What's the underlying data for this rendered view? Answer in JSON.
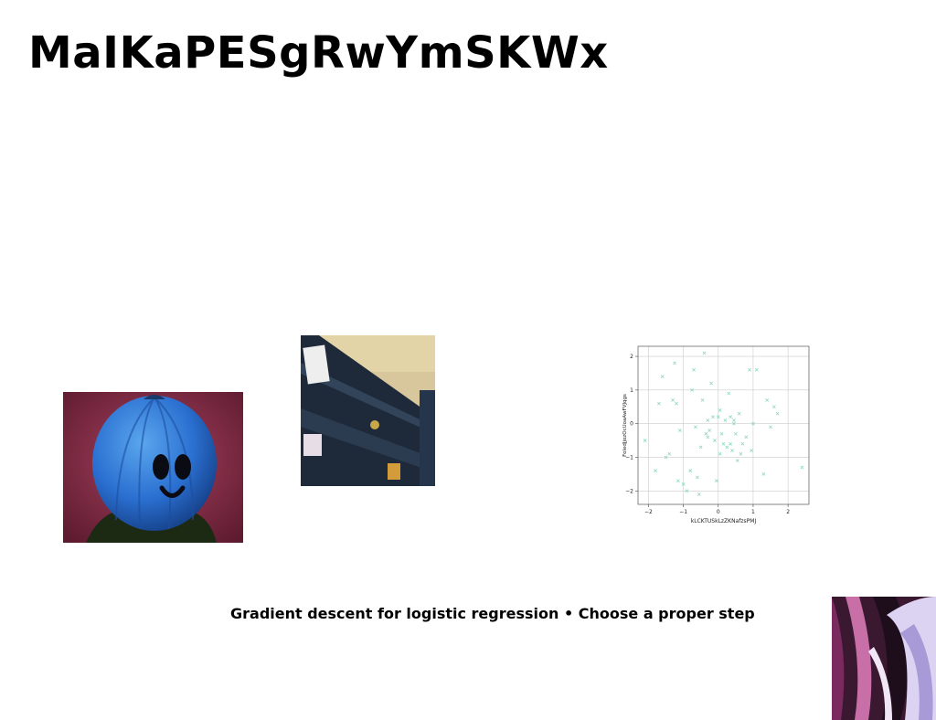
{
  "slide": {
    "title": "MaIKaPESgRwYmSKWx",
    "caption": "Gradient descent for logistic regression • Choose a proper step"
  },
  "colors": {
    "background": "#ffffff",
    "text": "#000000",
    "marker": "#8fd8c0"
  },
  "chart_data": {
    "type": "scatter",
    "title": "",
    "xlabel": "kLCKTUSkLzZKNafzsPMJ",
    "ylabel": "FoledJjozOcUoaAwFVJqgs",
    "xlim": [
      -2.3,
      2.6
    ],
    "ylim": [
      -2.4,
      2.3
    ],
    "xticks": [
      "-2",
      "-1",
      "0",
      "1",
      "2"
    ],
    "yticks": [
      "-2",
      "-1",
      "0",
      "1",
      "2"
    ],
    "grid": true,
    "marker": "x",
    "x": [
      -2.1,
      -1.8,
      -1.7,
      -1.6,
      -1.5,
      -1.4,
      -1.3,
      -1.25,
      -1.2,
      -1.15,
      -1.1,
      -1.0,
      -0.9,
      -0.8,
      -0.7,
      -0.65,
      -0.6,
      -0.5,
      -0.45,
      -0.4,
      -0.35,
      -0.3,
      -0.25,
      -0.2,
      -0.15,
      -0.1,
      -0.05,
      0.0,
      0.05,
      0.1,
      0.15,
      0.2,
      0.25,
      0.3,
      0.35,
      0.4,
      0.45,
      0.5,
      0.55,
      0.6,
      0.7,
      0.8,
      0.9,
      1.0,
      1.1,
      1.3,
      1.4,
      1.5,
      1.6,
      1.7,
      2.4,
      -0.55,
      0.05,
      0.35,
      -0.3,
      0.45,
      0.65,
      0.95,
      -0.75
    ],
    "y": [
      -0.5,
      -1.4,
      0.6,
      1.4,
      -1.0,
      -0.9,
      0.7,
      1.8,
      0.6,
      -1.7,
      -0.2,
      -1.8,
      -2.0,
      -1.4,
      1.6,
      -0.1,
      -1.6,
      -0.7,
      0.7,
      2.1,
      -0.3,
      0.1,
      -0.2,
      1.2,
      0.2,
      -0.5,
      -1.7,
      0.2,
      -0.9,
      -0.3,
      -0.6,
      0.1,
      -0.7,
      0.9,
      0.2,
      -0.8,
      0.0,
      -0.3,
      -1.1,
      0.3,
      -0.6,
      -0.4,
      1.6,
      0.0,
      1.6,
      -1.5,
      0.7,
      -0.1,
      0.5,
      0.3,
      -1.3,
      -2.1,
      0.4,
      -0.6,
      -0.4,
      0.1,
      -0.9,
      -0.8,
      1.0
    ]
  }
}
